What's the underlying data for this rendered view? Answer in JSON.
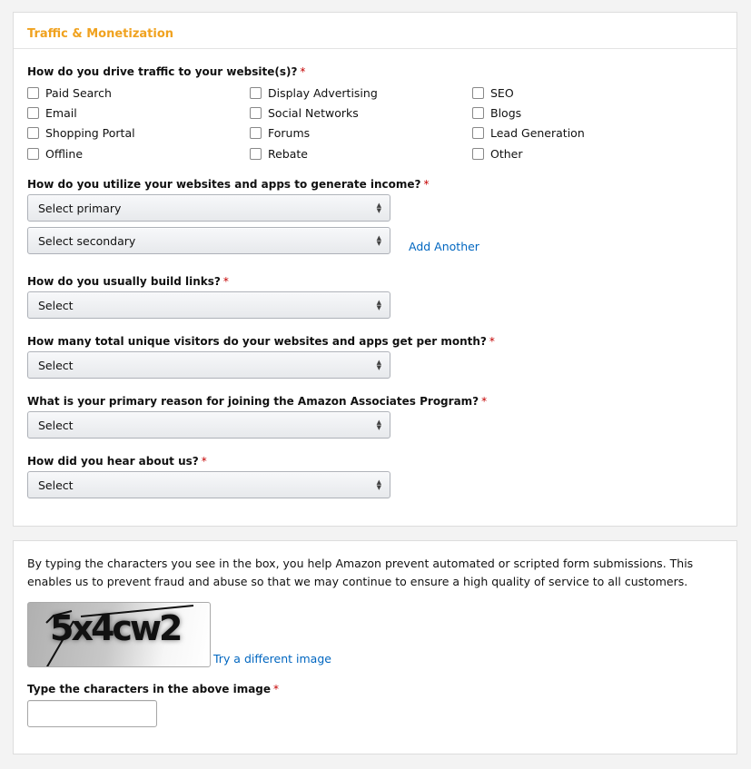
{
  "section1": {
    "title": "Traffic & Monetization",
    "traffic_question": "How do you drive traffic to your website(s)?",
    "required_mark": "*",
    "traffic_options": {
      "col1": [
        "Paid Search",
        "Email",
        "Shopping Portal",
        "Offline"
      ],
      "col2": [
        "Display Advertising",
        "Social Networks",
        "Forums",
        "Rebate"
      ],
      "col3": [
        "SEO",
        "Blogs",
        "Lead Generation",
        "Other"
      ]
    },
    "income_question": "How do you utilize your websites and apps to generate income?",
    "income_primary": "Select primary",
    "income_secondary": "Select secondary",
    "add_another": "Add Another",
    "links_question": "How do you usually build links?",
    "links_select": "Select",
    "visitors_question": "How many total unique visitors do your websites and apps get per month?",
    "visitors_select": "Select",
    "reason_question": "What is your primary reason for joining the Amazon Associates Program?",
    "reason_select": "Select",
    "hear_question": "How did you hear about us?",
    "hear_select": "Select"
  },
  "section2": {
    "description": "By typing the characters you see in the box, you help Amazon prevent automated or scripted form submissions. This enables us to prevent fraud and abuse so that we may continue to ensure a high quality of service to all customers.",
    "captcha_text": "5x4cw2",
    "try_different": "Try a different image",
    "captcha_label": "Type the characters in the above image",
    "captcha_value": ""
  },
  "colors": {
    "accent": "#f0a21f",
    "link": "#0066c0",
    "required": "#c40000"
  }
}
